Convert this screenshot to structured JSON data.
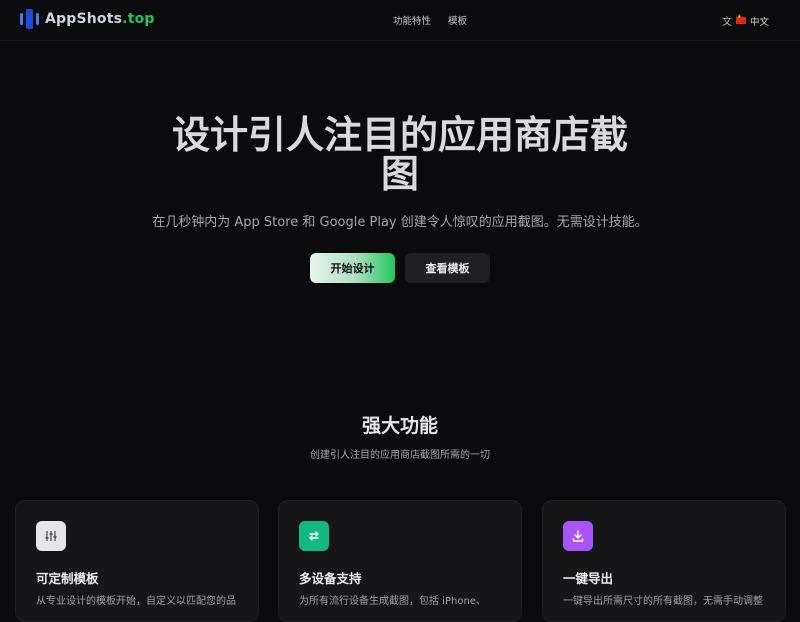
{
  "header": {
    "brand_main": "AppShots",
    "brand_tld": ".top",
    "menu": [
      "功能特性",
      "模板"
    ],
    "lang_label": "中文"
  },
  "hero": {
    "title_line1": "设计引人注目的应用商店截",
    "title_line2": "图",
    "subtitle": "在几秒钟内为 App Store 和 Google Play 创建令人惊叹的应用截图。无需设计技能。",
    "primary_button": "开始设计",
    "secondary_button": "查看模板"
  },
  "features": {
    "title": "强大功能",
    "subtitle": "创建引人注目的应用商店截图所需的一切",
    "cards": [
      {
        "icon": "sliders-icon",
        "title": "可定制模板",
        "desc": "从专业设计的模板开始，自定义以匹配您的品",
        "color": "#e6e6e8"
      },
      {
        "icon": "swap-icon",
        "title": "多设备支持",
        "desc": "为所有流行设备生成截图，包括 iPhone、",
        "color": "#10b981"
      },
      {
        "icon": "download-icon",
        "title": "一键导出",
        "desc": "一键导出所需尺寸的所有截图，无需手动调整",
        "color": "#a855f7"
      }
    ]
  }
}
